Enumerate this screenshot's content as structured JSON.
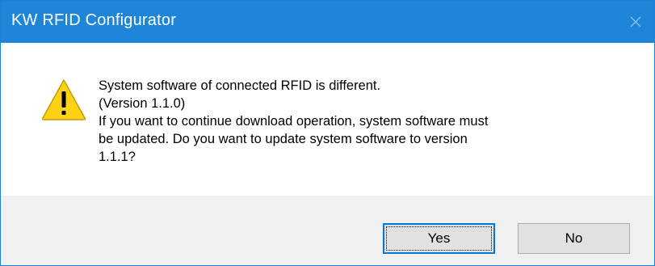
{
  "window": {
    "title": "KW RFID Configurator"
  },
  "message": {
    "lines": [
      "System software of connected RFID is different.",
      "(Version 1.1.0)",
      "If you want to continue download operation, system software must",
      "be updated. Do you want to update system software to version",
      "1.1.1?"
    ]
  },
  "buttons": {
    "yes_label": "Yes",
    "no_label": "No"
  },
  "icons": {
    "dialog_icon": "warning-icon",
    "close": "close-icon"
  },
  "colors": {
    "titlebar": "#1f85d8",
    "footer": "#f0f0f0",
    "warning_fill": "#fcd116",
    "accent": "#0078d7"
  }
}
